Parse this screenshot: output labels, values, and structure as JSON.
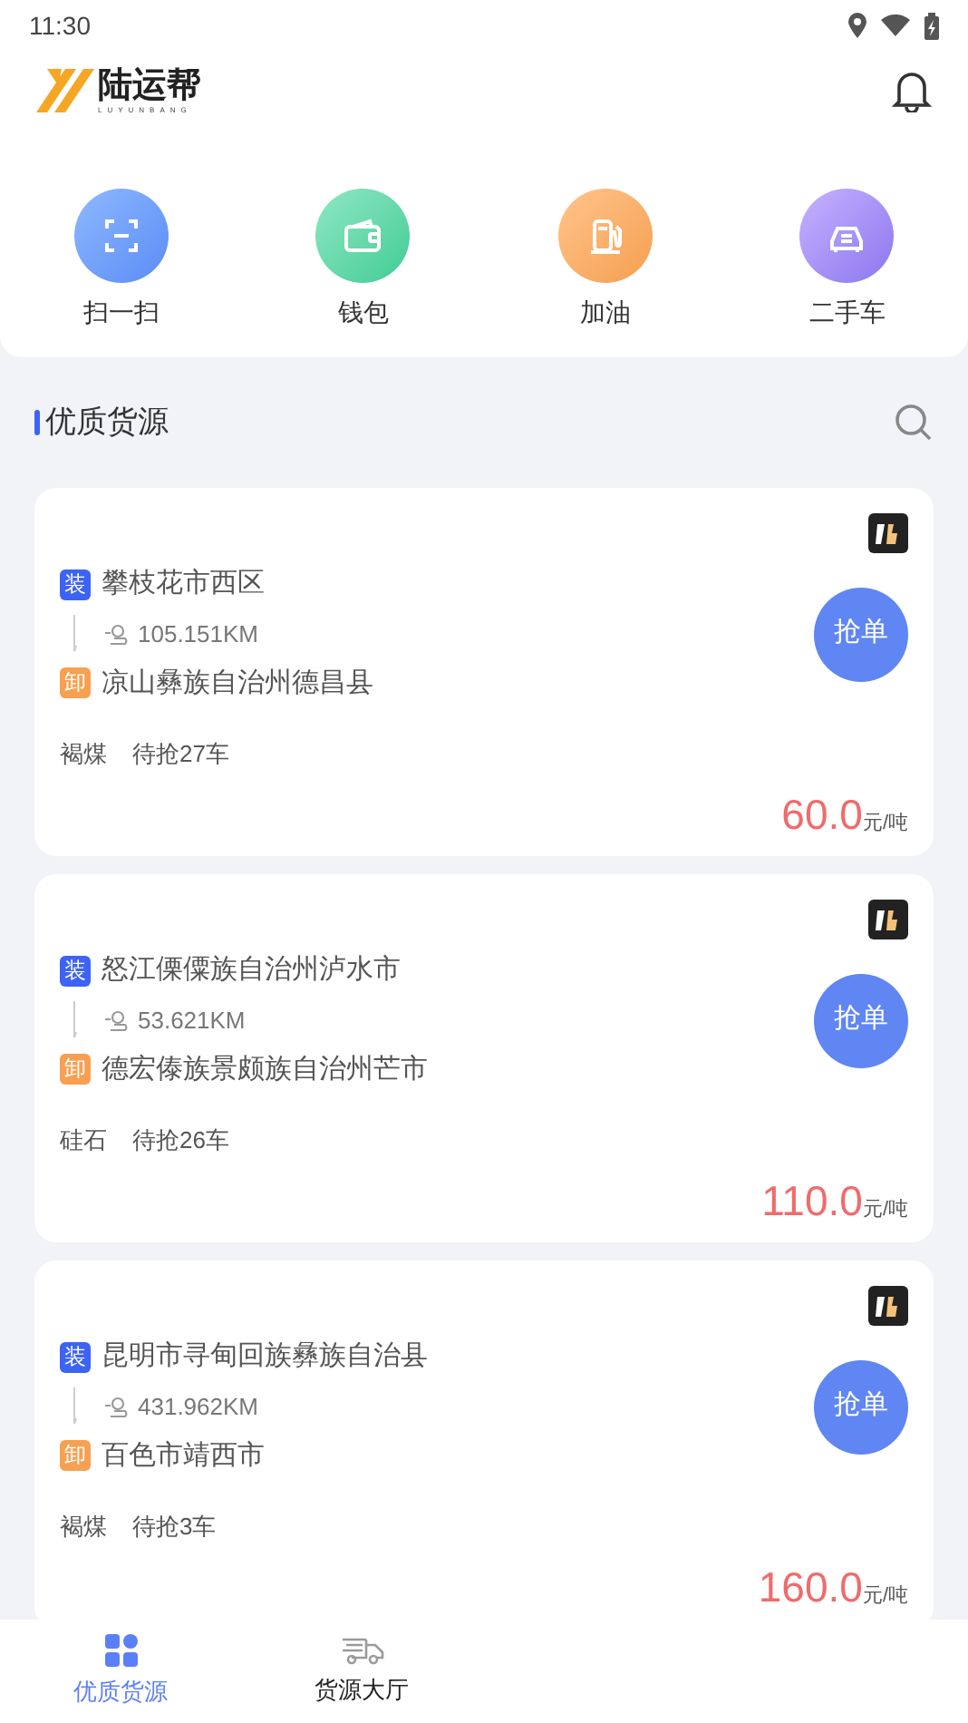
{
  "status_bar": {
    "time": "11:30"
  },
  "header": {
    "logo_text": "陆运帮",
    "logo_subtext": "LUYUNBANG"
  },
  "shortcuts": [
    {
      "kind": "scan",
      "label": "扫一扫"
    },
    {
      "kind": "wallet",
      "label": "钱包"
    },
    {
      "kind": "fuel",
      "label": "加油"
    },
    {
      "kind": "car",
      "label": "二手车"
    }
  ],
  "section": {
    "title": "优质货源"
  },
  "orders": [
    {
      "load_tag": "装",
      "from": "攀枝花市西区",
      "distance": "105.151KM",
      "unload_tag": "卸",
      "to": "凉山彝族自治州德昌县",
      "cargo": "褐煤",
      "remaining": "待抢27车",
      "price": "60.0",
      "unit": "元/吨",
      "button": "抢单"
    },
    {
      "load_tag": "装",
      "from": "怒江傈僳族自治州泸水市",
      "distance": "53.621KM",
      "unload_tag": "卸",
      "to": "德宏傣族景颇族自治州芒市",
      "cargo": "硅石",
      "remaining": "待抢26车",
      "price": "110.0",
      "unit": "元/吨",
      "button": "抢单"
    },
    {
      "load_tag": "装",
      "from": "昆明市寻甸回族彝族自治县",
      "distance": "431.962KM",
      "unload_tag": "卸",
      "to": "百色市靖西市",
      "cargo": "褐煤",
      "remaining": "待抢3车",
      "price": "160.0",
      "unit": "元/吨",
      "button": "抢单"
    }
  ],
  "bottom_nav": [
    {
      "kind": "grid",
      "label": "优质货源",
      "selected": true
    },
    {
      "kind": "truck",
      "label": "货源大厅",
      "selected": false
    }
  ]
}
